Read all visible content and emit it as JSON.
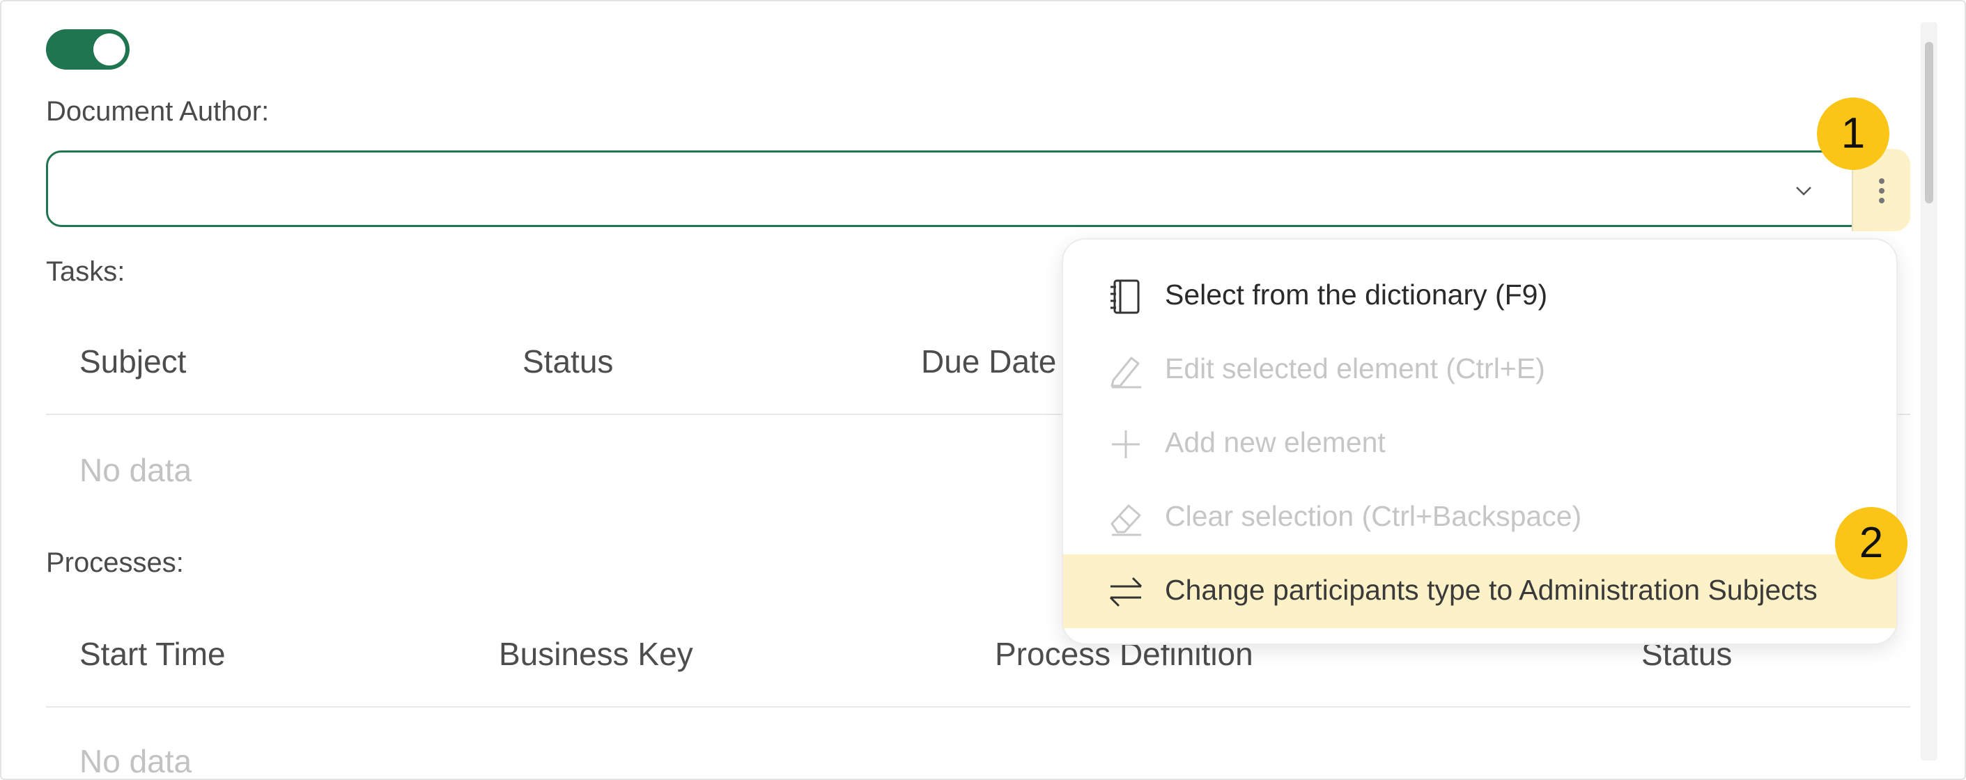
{
  "form": {
    "toggle_on": true,
    "author_label": "Document Author:",
    "author_value": "",
    "tasks_label": "Tasks:",
    "processes_label": "Processes:"
  },
  "tasks_table": {
    "columns": [
      "Subject",
      "Status",
      "Due Date"
    ],
    "empty_text": "No data"
  },
  "processes_table": {
    "columns": [
      "Start Time",
      "Business Key",
      "Process Definition",
      "Status"
    ],
    "empty_text": "No data"
  },
  "context_menu": {
    "items": [
      {
        "label": "Select from the dictionary (F9)",
        "icon": "notebook-icon",
        "state": "enabled"
      },
      {
        "label": "Edit selected element (Ctrl+E)",
        "icon": "pencil-icon",
        "state": "disabled"
      },
      {
        "label": "Add new element",
        "icon": "plus-icon",
        "state": "disabled"
      },
      {
        "label": "Clear selection (Ctrl+Backspace)",
        "icon": "eraser-icon",
        "state": "disabled"
      },
      {
        "label": "Change participants type to Administration Subjects",
        "icon": "swap-arrows-icon",
        "state": "highlighted"
      }
    ]
  },
  "callouts": [
    "1",
    "2"
  ],
  "colors": {
    "accent": "#1e7550",
    "highlight": "#fdf1c7",
    "callout": "#fbc518"
  }
}
